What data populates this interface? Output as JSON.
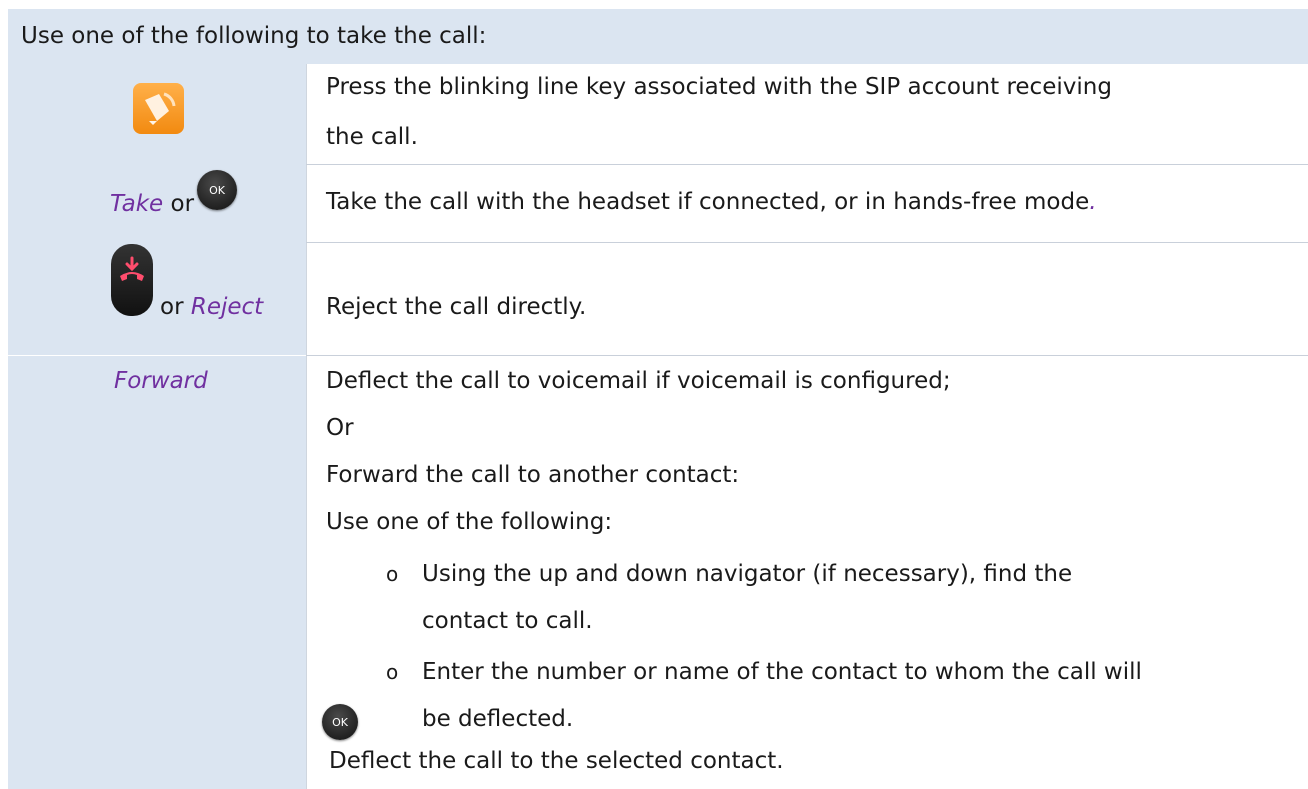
{
  "header": {
    "text": "Use one of the following to take the call:"
  },
  "rows": [
    {
      "left": {
        "icon": "bell-answer-icon"
      },
      "right": [
        "Press the blinking line key associated with the SIP account receiving",
        "the call."
      ]
    },
    {
      "left": {
        "italic": "Take",
        "connector": "or",
        "icon": "ok-key-icon",
        "key_label": "OK"
      },
      "right": [
        "Take the call with the headset if connected, or in hands-free mode",
        "."
      ]
    },
    {
      "left": {
        "icon": "hang-up-key-icon",
        "connector": "or",
        "italic": "Reject"
      },
      "right": [
        "Reject the call directly."
      ]
    },
    {
      "left": {
        "italic": "Forward"
      },
      "right": [
        "Deflect the call to voicemail if voicemail is configured;",
        "Or",
        "Forward the call to another contact:",
        "Use one of the following:"
      ],
      "bullets": [
        [
          "Using the up and down navigator (if necessary), find the",
          "contact to call."
        ],
        [
          "Enter the number or name of the contact to whom the call will",
          "be deflected."
        ]
      ],
      "bullet_symbol": "o",
      "final": {
        "icon": "ok-key-icon",
        "key_label": "OK",
        "text": "Deflect the call to the selected contact."
      }
    }
  ],
  "colors": {
    "table_shade": "#dbe5f1",
    "italic_accent": "#7030a0",
    "bell_orange": "#f28a10",
    "hangup_red": "#ff4d6d"
  }
}
